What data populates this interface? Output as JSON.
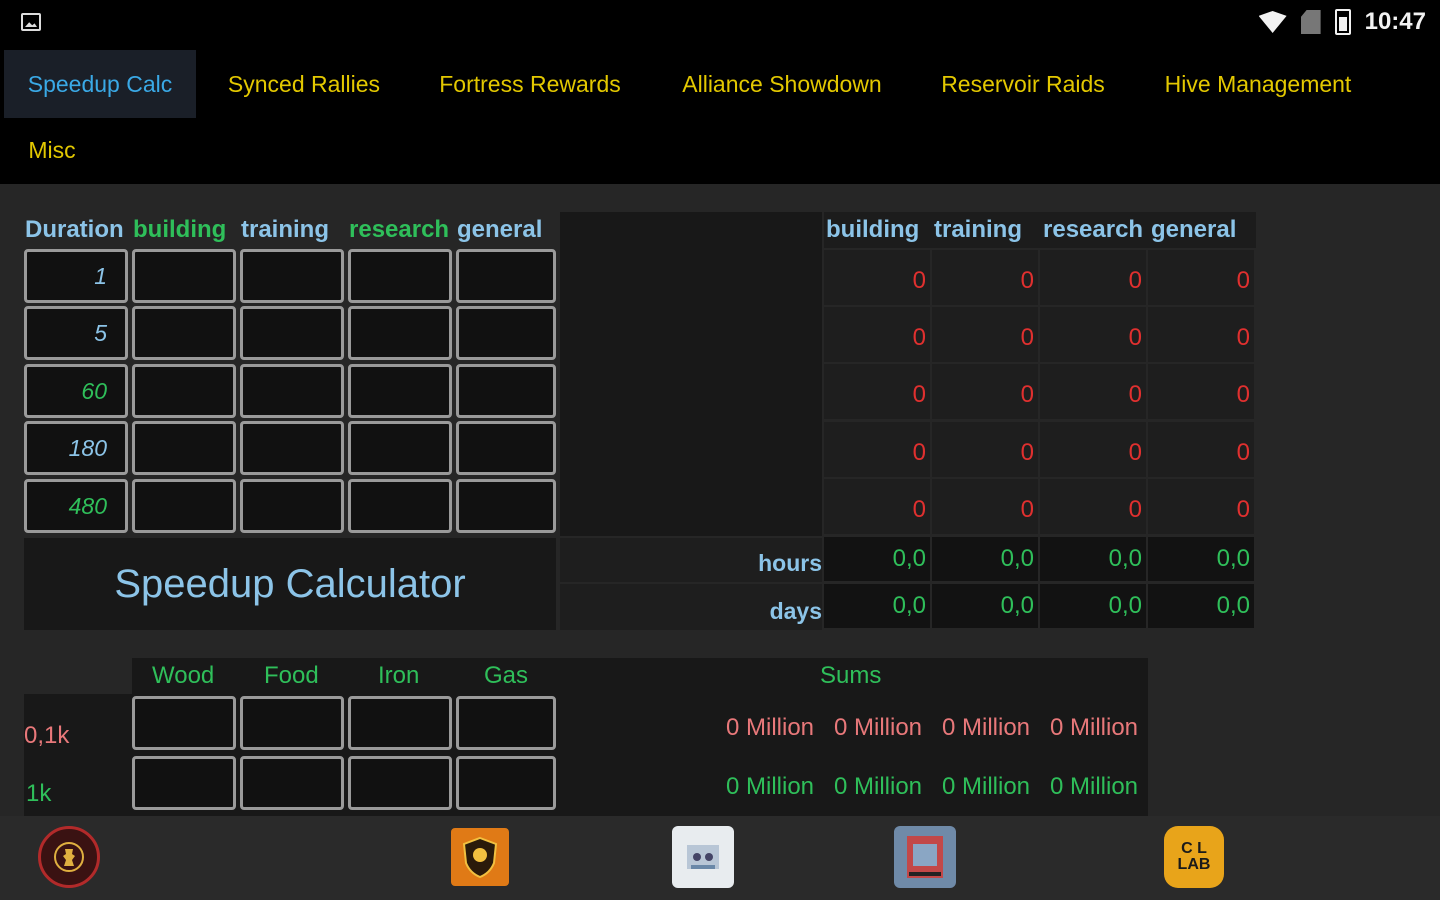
{
  "status_bar": {
    "time": "10:47"
  },
  "tabs": [
    {
      "label": "Speedup Calc",
      "active": true
    },
    {
      "label": "Synced Rallies",
      "active": false
    },
    {
      "label": "Fortress Rewards",
      "active": false
    },
    {
      "label": "Alliance Showdown",
      "active": false
    },
    {
      "label": "Reservoir Raids",
      "active": false
    },
    {
      "label": "Hive Management",
      "active": false
    },
    {
      "label": "Misc",
      "active": false
    }
  ],
  "input_table": {
    "headers": [
      "Duration",
      "building",
      "training",
      "research",
      "general"
    ],
    "durations": [
      "1",
      "5",
      "60",
      "180",
      "480"
    ]
  },
  "output_table": {
    "headers": [
      "building",
      "training",
      "research",
      "general"
    ],
    "rows": [
      [
        "0",
        "0",
        "0",
        "0"
      ],
      [
        "0",
        "0",
        "0",
        "0"
      ],
      [
        "0",
        "0",
        "0",
        "0"
      ],
      [
        "0",
        "0",
        "0",
        "0"
      ],
      [
        "0",
        "0",
        "0",
        "0"
      ]
    ],
    "hours_label": "hours",
    "hours": [
      "0,0",
      "0,0",
      "0,0",
      "0,0"
    ],
    "days_label": "days",
    "days": [
      "0,0",
      "0,0",
      "0,0",
      "0,0"
    ]
  },
  "title": "Speedup Calculator",
  "resources": {
    "headers": [
      "Wood",
      "Food",
      "Iron",
      "Gas"
    ],
    "sums_label": "Sums",
    "rows": [
      {
        "label": "0,1k",
        "sums": [
          "0 Million",
          "0 Million",
          "0 Million",
          "0 Million"
        ]
      },
      {
        "label": "1k",
        "sums": [
          "0 Million",
          "0 Million",
          "0 Million",
          "0 Million"
        ]
      }
    ]
  },
  "bottom_nav": [
    {
      "icon": "chess-emblem-icon"
    },
    {
      "icon": "shield-emblem-icon"
    },
    {
      "icon": "group-photo-icon"
    },
    {
      "icon": "poster-icon"
    },
    {
      "icon": "col-lab-icon",
      "text": "C L LAB"
    }
  ],
  "colors": {
    "tab_text": "#e3c800",
    "tab_active": "#3aa9e6",
    "header_blue": "#8cc4e8",
    "header_green": "#2fbf5a",
    "zero_red": "#e0302f",
    "background": "#262626"
  }
}
